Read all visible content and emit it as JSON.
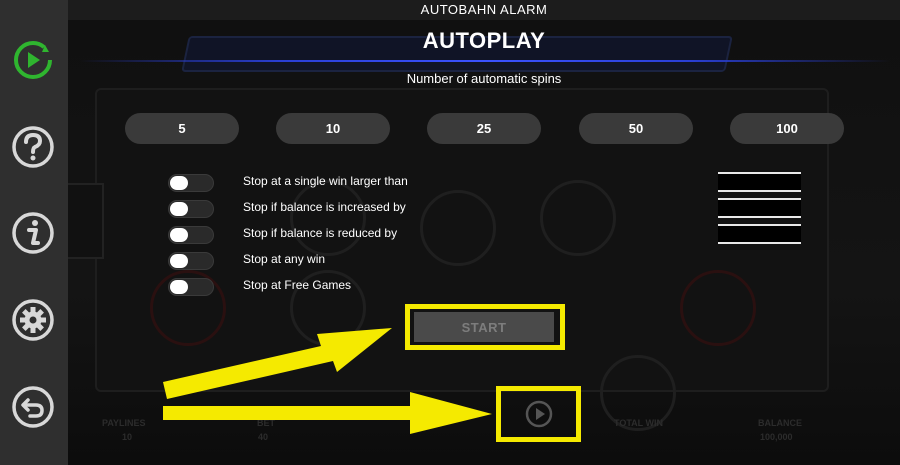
{
  "app_title": "AUTOBAHN ALARM",
  "panel_title": "AUTOPLAY",
  "subtitle": "Number of automatic spins",
  "spin_options": [
    "5",
    "10",
    "25",
    "50",
    "100"
  ],
  "stop_options": [
    {
      "label": "Stop at a single win larger than",
      "has_value": true,
      "value": ""
    },
    {
      "label": "Stop if balance is increased by",
      "has_value": true,
      "value": ""
    },
    {
      "label": "Stop if balance is reduced by",
      "has_value": true,
      "value": ""
    },
    {
      "label": "Stop at any win",
      "has_value": false
    },
    {
      "label": "Stop at Free Games",
      "has_value": false
    }
  ],
  "start_label": "START",
  "sidebar": [
    "autoplay-icon",
    "help-icon",
    "info-icon",
    "settings-icon",
    "back-icon"
  ],
  "bottom_bar": {
    "paylines_label": "PAYLINES",
    "paylines_value": "10",
    "bet_label": "BET",
    "bet_value": "40",
    "total_win_label": "TOTAL WIN",
    "balance_label": "BALANCE",
    "balance_value": "100,000"
  },
  "colors": {
    "accent_green": "#2fb52f",
    "highlight_yellow": "#f5ea00",
    "title_rule_blue": "#3b52ff"
  }
}
